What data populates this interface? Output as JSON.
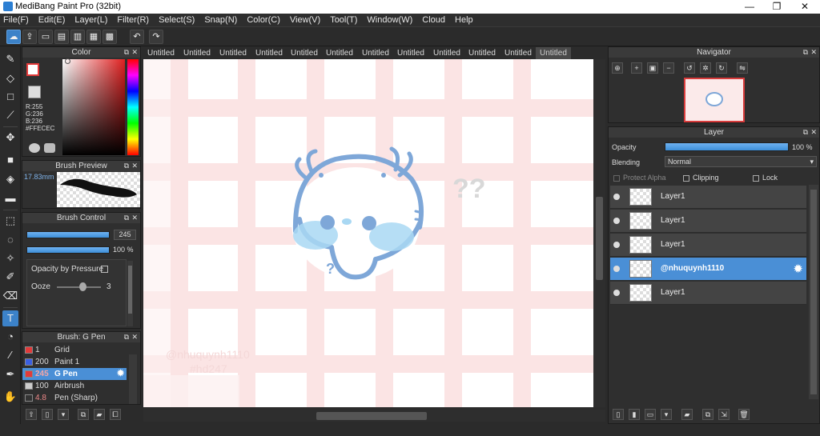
{
  "window": {
    "title": "MediBang Paint Pro (32bit)",
    "minimize": "—",
    "maximize": "❐",
    "close": "✕"
  },
  "menu": [
    "File(F)",
    "Edit(E)",
    "Layer(L)",
    "Filter(R)",
    "Select(S)",
    "Snap(N)",
    "Color(C)",
    "View(V)",
    "Tool(T)",
    "Window(W)",
    "Cloud",
    "Help"
  ],
  "tabs": [
    "Untitled",
    "Untitled",
    "Untitled",
    "Untitled",
    "Untitled",
    "Untitled",
    "Untitled",
    "Untitled",
    "Untitled",
    "Untitled",
    "Untitled",
    "Untitled"
  ],
  "color_panel": {
    "title": "Color",
    "r": "R:255",
    "g": "G:236",
    "b": "B:236",
    "hex": "#FFECEC"
  },
  "brush_preview": {
    "title": "Brush Preview",
    "size": "17.83mm"
  },
  "brush_control": {
    "title": "Brush Control",
    "size_value": "245",
    "opacity_value": "100 %",
    "opacity_by_pressure": "Opacity by Pressure",
    "ooze_label": "Ooze",
    "ooze_value": "3"
  },
  "brush_list": {
    "title": "Brush: G Pen",
    "items": [
      {
        "size": "1",
        "name": "Grid",
        "color": "#e23a3a"
      },
      {
        "size": "200",
        "name": "Paint 1",
        "color": "#3a5fe2"
      },
      {
        "size": "245",
        "name": "G Pen",
        "color": "#e23a3a"
      },
      {
        "size": "100",
        "name": "Airbrush",
        "color": "#cccccc"
      },
      {
        "size": "4.8",
        "name": "Pen (Sharp)",
        "color": "#333333"
      }
    ]
  },
  "navigator": {
    "title": "Navigator"
  },
  "layer_panel": {
    "title": "Layer",
    "opacity_label": "Opacity",
    "opacity_value": "100 %",
    "blending_label": "Blending",
    "blending_value": "Normal",
    "protect_alpha": "Protect Alpha",
    "clipping": "Clipping",
    "lock": "Lock",
    "layers": [
      "Layer1",
      "Layer1",
      "Layer1",
      "@nhuquynh1110",
      "Layer1"
    ]
  },
  "canvas": {
    "watermark_line1": "@nhuquynh1110",
    "watermark_line2": "#hd247",
    "question_marks": "??",
    "small_question": "?"
  },
  "colors": {
    "accent": "#4a8fd6",
    "grid_pink": "#fbe3e3",
    "doodle_blue": "#7ea7d8",
    "blush": "#a9d8f3"
  }
}
